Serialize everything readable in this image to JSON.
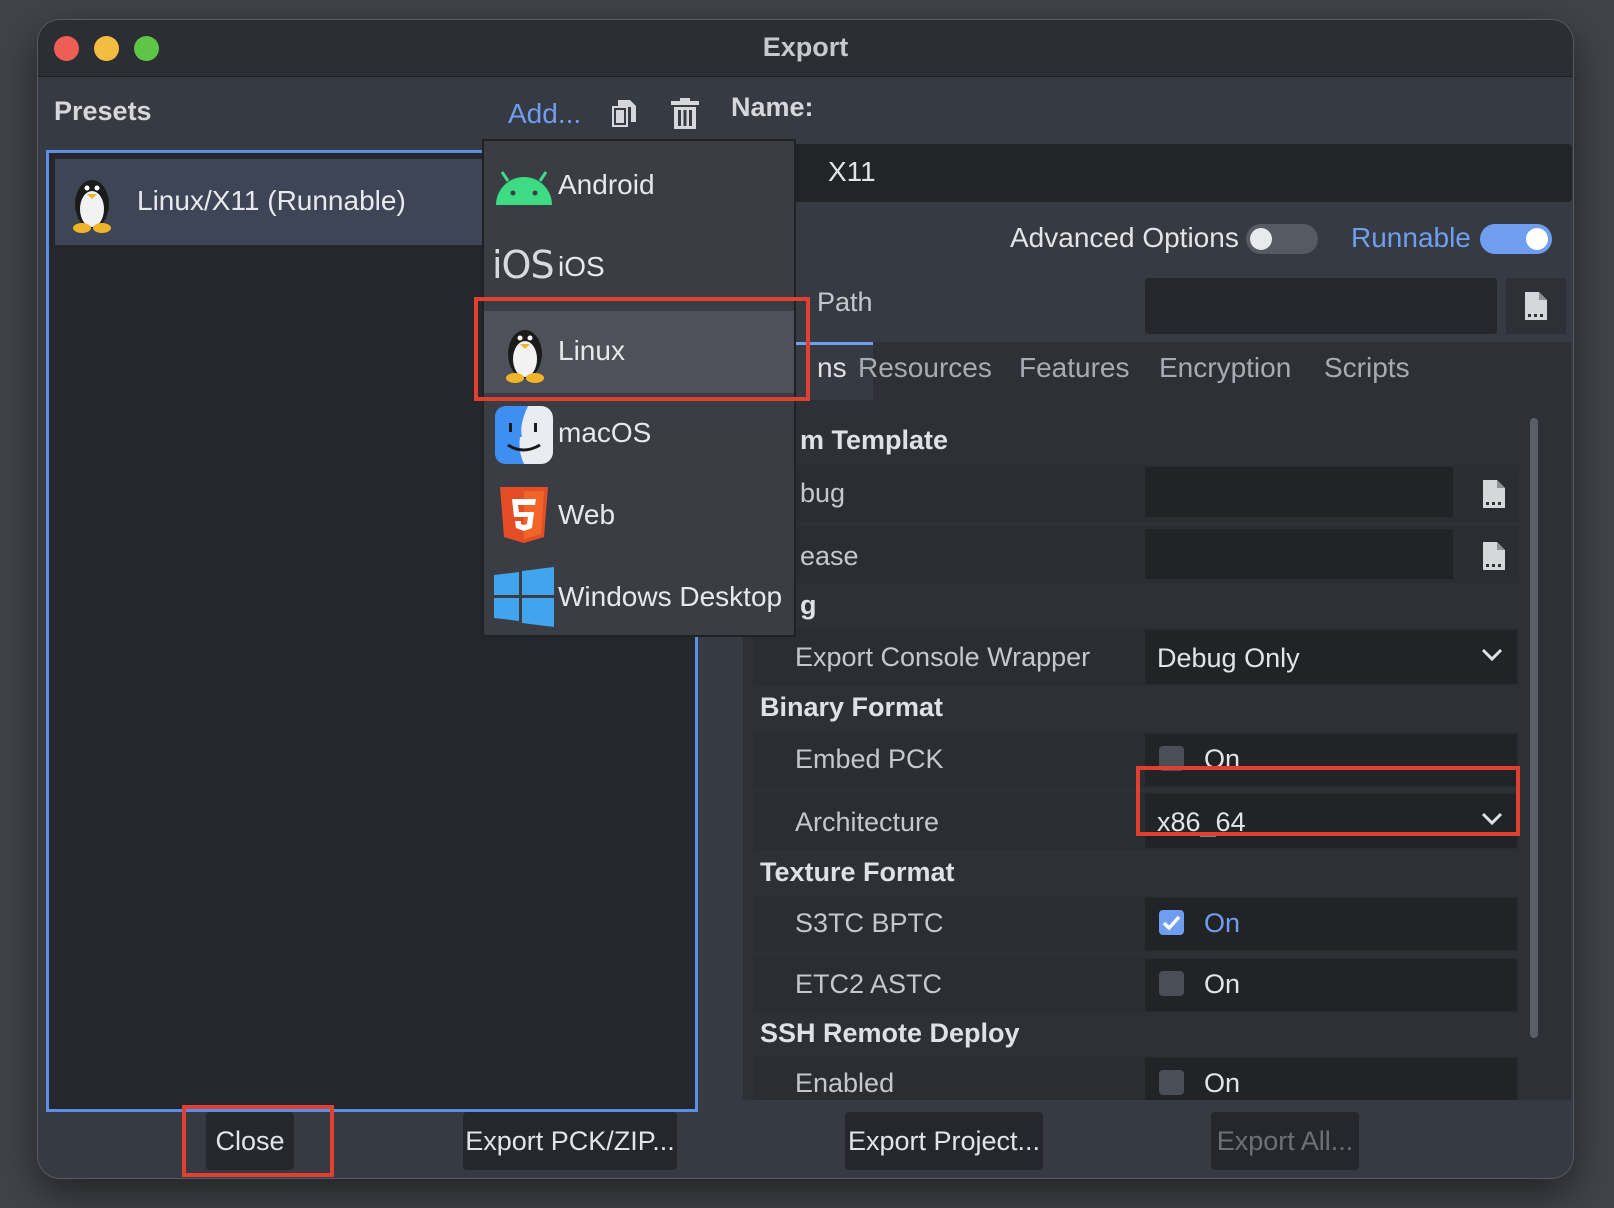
{
  "window": {
    "title": "Export"
  },
  "presets": {
    "label": "Presets",
    "add_label": "Add...",
    "items": [
      {
        "label": "Linux/X11 (Runnable)",
        "icon": "tux-icon"
      }
    ]
  },
  "name": {
    "label": "Name:",
    "value": "X11"
  },
  "options_toggles": {
    "advanced_label": "Advanced Options",
    "advanced_on": false,
    "runnable_label": "Runnable",
    "runnable_on": true
  },
  "export_path": {
    "label": "Path",
    "value": ""
  },
  "tabs": [
    {
      "label": "ns",
      "active": true
    },
    {
      "label": "Resources",
      "active": false
    },
    {
      "label": "Features",
      "active": false
    },
    {
      "label": "Encryption",
      "active": false
    },
    {
      "label": "Scripts",
      "active": false
    }
  ],
  "options": {
    "custom_template": {
      "title": "m Template",
      "debug_label": "bug",
      "release_label": "ease"
    },
    "debugging": {
      "title": "g",
      "console_wrapper_label": "Export Console Wrapper",
      "console_wrapper_value": "Debug Only"
    },
    "binary_format": {
      "title": "Binary Format",
      "embed_pck_label": "Embed PCK",
      "embed_pck_value": "On",
      "embed_pck_checked": false,
      "architecture_label": "Architecture",
      "architecture_value": "x86_64"
    },
    "texture_format": {
      "title": "Texture Format",
      "s3tc_label": "S3TC BPTC",
      "s3tc_value": "On",
      "s3tc_checked": true,
      "etc2_label": "ETC2 ASTC",
      "etc2_value": "On",
      "etc2_checked": false
    },
    "ssh": {
      "title": "SSH Remote Deploy",
      "enabled_label": "Enabled",
      "enabled_value": "On"
    }
  },
  "dropdown": {
    "items": [
      {
        "label": "Android",
        "icon": "android-icon"
      },
      {
        "label": "iOS",
        "icon_text": "iOS",
        "icon": "ios-icon"
      },
      {
        "label": "Linux",
        "icon": "tux-icon",
        "highlighted": true
      },
      {
        "label": "macOS",
        "icon": "finder-icon"
      },
      {
        "label": "Web",
        "icon": "html5-icon"
      },
      {
        "label": "Windows Desktop",
        "icon": "windows-icon"
      }
    ]
  },
  "buttons": {
    "close": "Close",
    "export_pck": "Export PCK/ZIP...",
    "export_project": "Export Project...",
    "export_all": "Export All..."
  },
  "colors": {
    "accent": "#6f9ef0",
    "annotation": "#e0402f",
    "traffic_red": "#ee5e57",
    "traffic_yellow": "#f4bd3f",
    "traffic_green": "#5fc546"
  }
}
